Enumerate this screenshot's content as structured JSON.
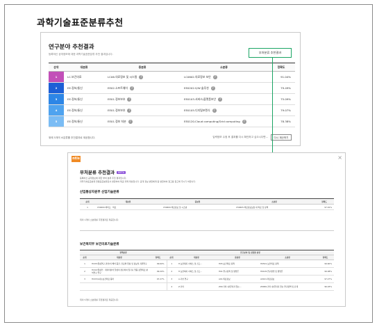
{
  "page": {
    "title": "과학기술표준분류추천"
  },
  "rec": {
    "title": "연구분야 추천결과",
    "subtitle": "등록하신 공개정보에 대한 과학기술표준분류 추천 결과입니다.",
    "sub_button": "부처분류 추천결과",
    "headers": [
      "순위",
      "대분류",
      "중분류",
      "소분류",
      "정확도"
    ],
    "rows": [
      {
        "rank": "1",
        "color": "#c24fb8",
        "c1": "LC.보건의료",
        "c2": "LC06.의료정보 및 시스템",
        "c3": "LC0602.의료정보 보안",
        "c4": "91.04%"
      },
      {
        "rank": "2",
        "color": "#1d5fd6",
        "c1": "EE.정보/통신",
        "c2": "EE02.소프트웨어",
        "c3": "EE0202.S/W 솔루션",
        "c4": "79.49%"
      },
      {
        "rank": "3",
        "color": "#2d86e6",
        "c1": "EE.정보/통신",
        "c2": "EE01.정보보호",
        "c3": "EE0103.서버스/플랫폼보안",
        "c4": "75.09%"
      },
      {
        "rank": "4",
        "color": "#4fa3ef",
        "c1": "EE.정보/통신",
        "c2": "EE01.정보보호",
        "c3": "EE0105.디지털포렌식",
        "c4": "79.07%"
      },
      {
        "rank": "5",
        "color": "#7bbcf4",
        "c1": "EE.정보/통신",
        "c2": "EE01.정보 처분",
        "c3": "EE0120.Cloud computing/Grid computing",
        "c4": "78.38%"
      }
    ],
    "footer_left": "위에 5개의 소분류를 추천결과로 제공합니다.",
    "footer_right": "입력정보 수정 후 결과를 다시 확인하고 싶으시다면...",
    "footer_button": "다시 계산하기"
  },
  "modal": {
    "logo": "ntis",
    "close": "×",
    "title": "부처분류 추천결과",
    "badge": "BETA",
    "desc1": "등록하신 공개정보에 대한 부처 분류 추천 결과입니다.",
    "desc2": "과학기술표준분류 연결표준분류로서 변환하여 제공 과제 대상입니다. 공개 정보 변환체계 등 변환하여 참고용 참고해 주시기 바랍니다.",
    "section1": {
      "title": "산업통상자원부 산업기술분류",
      "headers": [
        "순위",
        "대분류",
        "중분류",
        "소분류",
        "정확도"
      ],
      "rows": [
        {
          "c0": "1",
          "c1": "C50000.바이오 · 의료",
          "c2": "C50600.의료정보 및 시스템",
          "c3": "C50605.의료정보보호 내 의료 및 정책",
          "c4": "97.91%"
        }
      ],
      "note": "위의 1개의 소분류를 추천결과로 제공합니다."
    },
    "section2": {
      "title": "보건복지부 보건의료기술분류",
      "group_left": "정책분류",
      "group_right": "연구분야 및 산출물 분류",
      "headers_left": [
        "순위",
        "대분류",
        "정확도"
      ],
      "headers_right": [
        "순위",
        "대분류",
        "중분류",
        "소분류",
        "정확도"
      ],
      "rows": [
        {
          "l0": "1",
          "l1": "HC05(임상연구 관련)이 해석 증진, 진료와 임상 및 정보적 지원연구",
          "l2": "99.60%",
          "r0": "1",
          "r1": "H.보건복지 서비스 및 신고...",
          "r2": "H05.보건의료 정책",
          "r3": "H0501.보건의료 정책",
          "r4": "99.60%"
        },
        {
          "l0": "2",
          "l1": "HC02(임상인 · 데이터분석 달성이 판단하여 임기니 행동 정밀의료 분석연구 연구",
          "l2": "99.20%",
          "r0": "2",
          "r1": "H.보건복지 서비스 및 신고...",
          "r2": "H01.연구정책 및 방법론",
          "r3": "H0105.연구방법 및 방법론",
          "r4": "99.08%"
        },
        {
          "l0": "3",
          "l1": "HC03(A사는보건의료 등터",
          "l2": "97.27%",
          "r0": "3",
          "r1": "A.기반 연구",
          "r2": "A01.의료정보",
          "r3": "A0101.의료정보",
          "r4": "97.27%"
        },
        {
          "l0": "",
          "l1": "",
          "l2": "",
          "r0": "4",
          "r1": "Z.기타",
          "r2": "Z99.기타 (분류되지 않는...",
          "r3": "Z9999.기타 (분류되지 않는 연구영역 및 단계",
          "r4": "96.93%"
        }
      ],
      "note": "위의 5개의 소분류를 추천결과로 제공합니다."
    }
  }
}
